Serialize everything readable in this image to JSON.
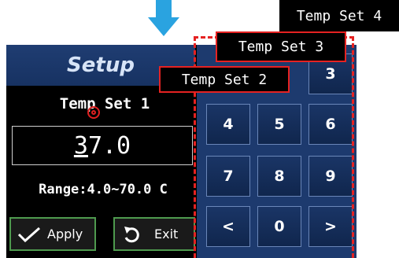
{
  "setup": {
    "title": "Setup",
    "field_label": "Temp Set 1",
    "value_first": "3",
    "value_rest": "7.0",
    "range_text": "Range:4.0~70.0 C"
  },
  "buttons": {
    "apply_label": "Apply",
    "exit_label": "Exit"
  },
  "keypad": {
    "keys": [
      "3",
      "4",
      "5",
      "6",
      "7",
      "8",
      "9",
      "<",
      "0",
      ">"
    ]
  },
  "callouts": {
    "set2": "Temp Set 2",
    "set3": "Temp Set 3",
    "set4": "Temp Set 4"
  },
  "colors": {
    "arrow": "#2aa3e0",
    "header_blue": "#1f3d72",
    "key_blue": "#1a3566",
    "button_border": "#4e9a4e",
    "highlight_red": "#e52222"
  },
  "icons": {
    "arrow": "arrow-down-icon",
    "apply": "checkmark-icon",
    "exit": "undo-icon",
    "marker": "circle-marker-icon"
  }
}
